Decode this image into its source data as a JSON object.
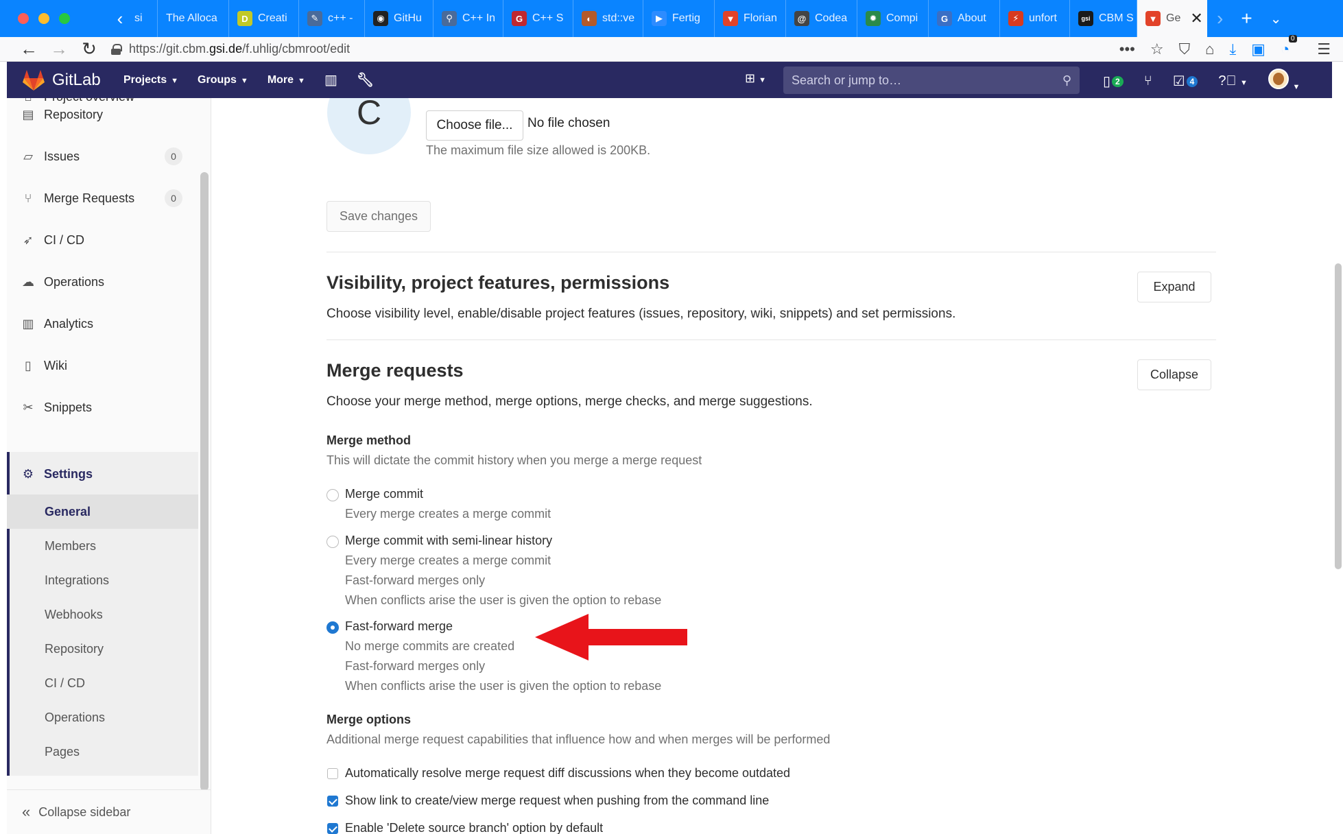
{
  "browser": {
    "tabs": [
      {
        "label": "si",
        "fav_color": "#7aa6d6",
        "fav_char": ""
      },
      {
        "label": "The Alloca",
        "fav_color": "#0a84ff",
        "fav_char": ""
      },
      {
        "label": "Creati",
        "fav_color": "#c2c928",
        "fav_char": "D"
      },
      {
        "label": "c++ -",
        "fav_color": "#4a6b9a",
        "fav_char": "✎"
      },
      {
        "label": "GitHu",
        "fav_color": "#222222",
        "fav_char": "◉"
      },
      {
        "label": "C++ In",
        "fav_color": "#4a6b9a",
        "fav_char": "⚲"
      },
      {
        "label": "C++ S",
        "fav_color": "#c0282f",
        "fav_char": "G"
      },
      {
        "label": "std::ve",
        "fav_color": "#b35a2a",
        "fav_char": "◐"
      },
      {
        "label": "Fertig",
        "fav_color": "#2d8cff",
        "fav_char": "▶"
      },
      {
        "label": "Florian",
        "fav_color": "#e24329",
        "fav_char": "▼"
      },
      {
        "label": "Codea",
        "fav_color": "#444444",
        "fav_char": "@"
      },
      {
        "label": "Compi",
        "fav_color": "#2a8a4a",
        "fav_char": "✹"
      },
      {
        "label": "About",
        "fav_color": "#3b6fc4",
        "fav_char": "G"
      },
      {
        "label": "unfort",
        "fav_color": "#d83a1f",
        "fav_char": "⚡"
      },
      {
        "label": "CBM S",
        "fav_color": "#1a1a1a",
        "fav_char": "gsi"
      },
      {
        "label": "Ge",
        "fav_color": "#e24329",
        "fav_char": "▼"
      }
    ],
    "url_prefix": "https://git.cbm.",
    "url_domain": "gsi.de",
    "url_suffix": "/f.uhlig/cbmroot/edit",
    "more_icon": "•••",
    "download_badge": "0"
  },
  "gitlab": {
    "logo_text": "GitLab",
    "menu": [
      "Projects",
      "Groups",
      "More"
    ],
    "search_placeholder": "Search or jump to…",
    "issues_count": "2",
    "todos_count": "4"
  },
  "sidebar": {
    "project_overview": "Project overview",
    "items": [
      {
        "label": "Repository",
        "icon": "doc-icon"
      },
      {
        "label": "Issues",
        "icon": "issues-icon",
        "badge": "0"
      },
      {
        "label": "Merge Requests",
        "icon": "merge-request-icon",
        "badge": "0"
      },
      {
        "label": "CI / CD",
        "icon": "rocket-icon"
      },
      {
        "label": "Operations",
        "icon": "cloud-icon"
      },
      {
        "label": "Analytics",
        "icon": "chart-icon"
      },
      {
        "label": "Wiki",
        "icon": "book-icon"
      },
      {
        "label": "Snippets",
        "icon": "scissors-icon"
      }
    ],
    "settings_label": "Settings",
    "sub_items": [
      "General",
      "Members",
      "Integrations",
      "Webhooks",
      "Repository",
      "CI / CD",
      "Operations",
      "Pages"
    ],
    "collapse_label": "Collapse sidebar"
  },
  "main": {
    "avatar_letter": "C",
    "choose_file_label": "Choose file...",
    "no_file_text": "No file chosen",
    "max_size_text": "The maximum file size allowed is 200KB.",
    "save_changes_label": "Save changes",
    "visibility": {
      "title": "Visibility, project features, permissions",
      "desc": "Choose visibility level, enable/disable project features (issues, repository, wiki, snippets) and set permissions.",
      "button": "Expand"
    },
    "merge_requests": {
      "title": "Merge requests",
      "desc": "Choose your merge method, merge options, merge checks, and merge suggestions.",
      "button": "Collapse",
      "method_label": "Merge method",
      "method_help": "This will dictate the commit history when you merge a merge request",
      "methods": [
        {
          "label": "Merge commit",
          "help": [
            "Every merge creates a merge commit"
          ],
          "checked": false
        },
        {
          "label": "Merge commit with semi-linear history",
          "help": [
            "Every merge creates a merge commit",
            "Fast-forward merges only",
            "When conflicts arise the user is given the option to rebase"
          ],
          "checked": false
        },
        {
          "label": "Fast-forward merge",
          "help": [
            "No merge commits are created",
            "Fast-forward merges only",
            "When conflicts arise the user is given the option to rebase"
          ],
          "checked": true
        }
      ],
      "options_label": "Merge options",
      "options_help": "Additional merge request capabilities that influence how and when merges will be performed",
      "options": [
        {
          "label": "Automatically resolve merge request diff discussions when they become outdated",
          "checked": false
        },
        {
          "label": "Show link to create/view merge request when pushing from the command line",
          "checked": true
        },
        {
          "label": "Enable 'Delete source branch' option by default",
          "checked": true
        }
      ]
    },
    "annotation_arrow_color": "#e8141a"
  }
}
